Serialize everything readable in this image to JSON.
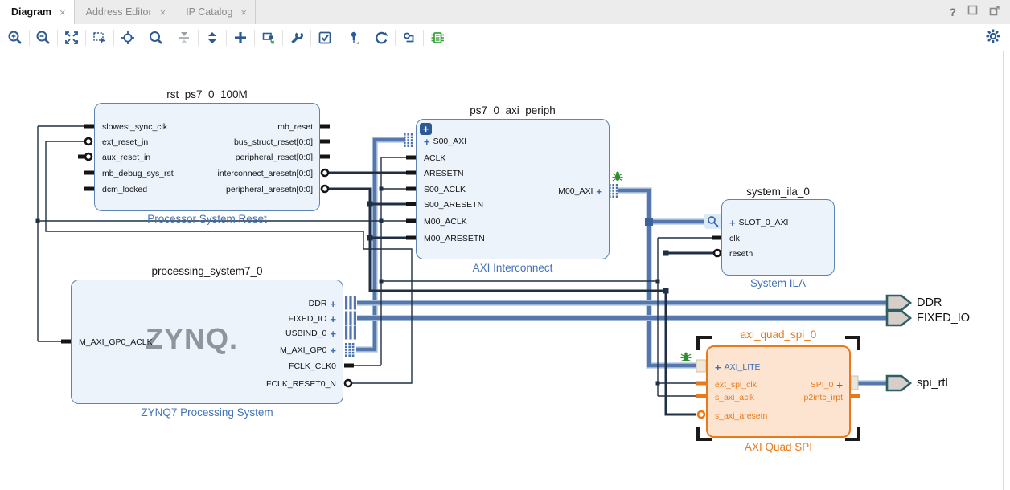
{
  "glyphs": {
    "plus": "+",
    "close": "×",
    "help": "?"
  },
  "tabs": [
    {
      "label": "Diagram",
      "active": true
    },
    {
      "label": "Address Editor",
      "active": false
    },
    {
      "label": "IP Catalog",
      "active": false
    }
  ],
  "toolbar": {
    "icons": [
      "zoom-in",
      "zoom-out",
      "zoom-fit",
      "zoom-to-selection",
      "fit-selection",
      "search",
      "collapse-hierarchy",
      "expand-hierarchy",
      "add-ip",
      "make-external",
      "customize-block",
      "validate-design",
      "pin-design",
      "regenerate-layout",
      "optimize-routing",
      "show-interface-connections"
    ],
    "right_icon": "settings-gear"
  },
  "colors": {
    "block_fill": "#ecf3fb",
    "block_border": "#5b83b5",
    "subtitle_text": "#4273b8",
    "selected_fill": "#fce4d1",
    "selected_border": "#e87a1c",
    "interface_wire": "#5577ad",
    "signal_wire": "#1f3044",
    "external_port_fill": "#d6cec8",
    "external_port_border": "#2c5f66",
    "debug_marker": "#2e8b2e"
  },
  "blocks": {
    "rst": {
      "instance": "rst_ps7_0_100M",
      "type_label": "Processor System Reset",
      "left_ports": [
        "slowest_sync_clk",
        "ext_reset_in",
        "aux_reset_in",
        "mb_debug_sys_rst",
        "dcm_locked"
      ],
      "right_ports": [
        "mb_reset",
        "bus_struct_reset[0:0]",
        "peripheral_reset[0:0]",
        "interconnect_aresetn[0:0]",
        "peripheral_aresetn[0:0]"
      ]
    },
    "interconnect": {
      "instance": "ps7_0_axi_periph",
      "type_label": "AXI Interconnect",
      "left_ports": [
        "S00_AXI",
        "ACLK",
        "ARESETN",
        "S00_ACLK",
        "S00_ARESETN",
        "M00_ACLK",
        "M00_ARESETN"
      ],
      "right_ports": [
        "M00_AXI"
      ]
    },
    "zynq": {
      "instance": "processing_system7_0",
      "type_label": "ZYNQ7 Processing System",
      "logo": "ZYNQ.",
      "left_ports": [
        "M_AXI_GP0_ACLK"
      ],
      "right_ports": [
        "DDR",
        "FIXED_IO",
        "USBIND_0",
        "M_AXI_GP0",
        "FCLK_CLK0",
        "FCLK_RESET0_N"
      ]
    },
    "ila": {
      "instance": "system_ila_0",
      "type_label": "System ILA",
      "left_ports": [
        "SLOT_0_AXI",
        "clk",
        "resetn"
      ]
    },
    "quad_spi": {
      "instance": "axi_quad_spi_0",
      "type_label": "AXI Quad SPI",
      "left_ports": [
        "AXI_LITE",
        "ext_spi_clk",
        "s_axi_aclk",
        "s_axi_aresetn"
      ],
      "right_ports": [
        "SPI_0",
        "ip2intc_irpt"
      ]
    }
  },
  "external_ports": [
    "DDR",
    "FIXED_IO",
    "spi_rtl"
  ]
}
